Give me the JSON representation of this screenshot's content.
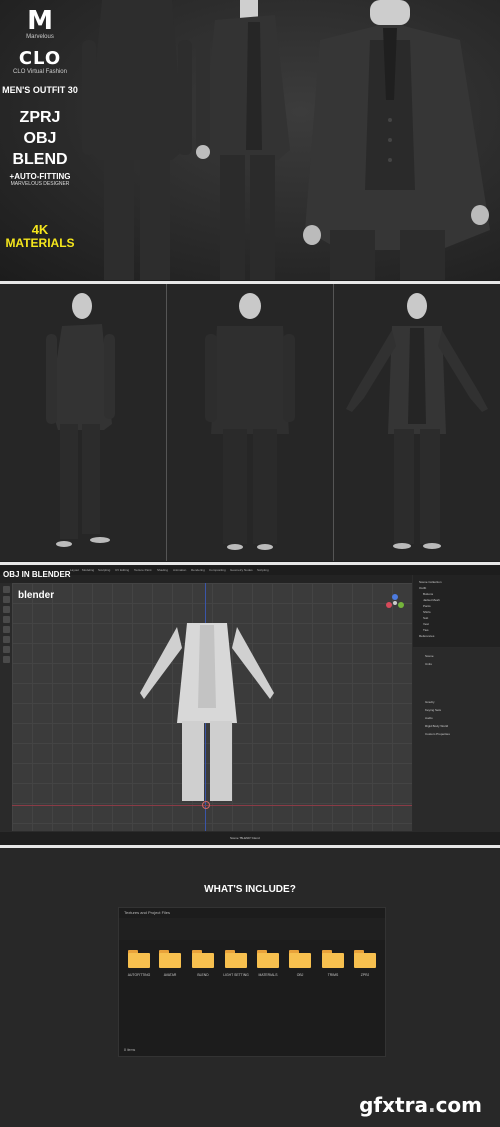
{
  "brand": {
    "logo_letter": "M",
    "logo_name": "Marvelous",
    "clo_logo": "CLO",
    "clo_sub": "CLO Virtual Fashion",
    "product_title": "MEN'S OUTFIT 30",
    "formats": [
      "ZPRJ",
      "OBJ",
      "BLEND"
    ],
    "auto_fitting": "+AUTO-FITTING",
    "auto_fitting_sub": "MARVELOUS DESIGNER",
    "materials_line1": "4K",
    "materials_line2": "MATERIALS",
    "accent_color": "#f5e61c"
  },
  "blender": {
    "label": "OBJ IN BLENDER",
    "logo_text": "blender",
    "workspace_tabs": [
      "Layout",
      "Modeling",
      "Sculpting",
      "UV Editing",
      "Texture Paint",
      "Shading",
      "Animation",
      "Rendering",
      "Compositing",
      "Geometry Nodes",
      "Scripting"
    ],
    "outliner_items": [
      "Scene Collection",
      "Outfit",
      "Buttons",
      "Jacket Mesh",
      "Pants",
      "Shirts",
      "Suit",
      "Vest",
      "Ties",
      "References"
    ],
    "properties_items": [
      "Scene",
      "Units",
      "Gravity",
      "Keying Sets",
      "Audio",
      "Rigid Body World",
      "Custom Properties"
    ],
    "status_file": "Scene \"BLEND\".blend"
  },
  "includes": {
    "heading": "WHAT'S INCLUDE?",
    "window_title": "Textures and Project Files",
    "folders": [
      "AUTOFITTING",
      "AVATAR",
      "BLEND",
      "LIGHT SETTING",
      "MATERIALS",
      "OBJ",
      "TRIMS",
      "ZPRJ"
    ],
    "status": "8 items"
  },
  "watermark": {
    "text_a": "gfxtra",
    "text_dot": ".",
    "text_b": "com"
  }
}
